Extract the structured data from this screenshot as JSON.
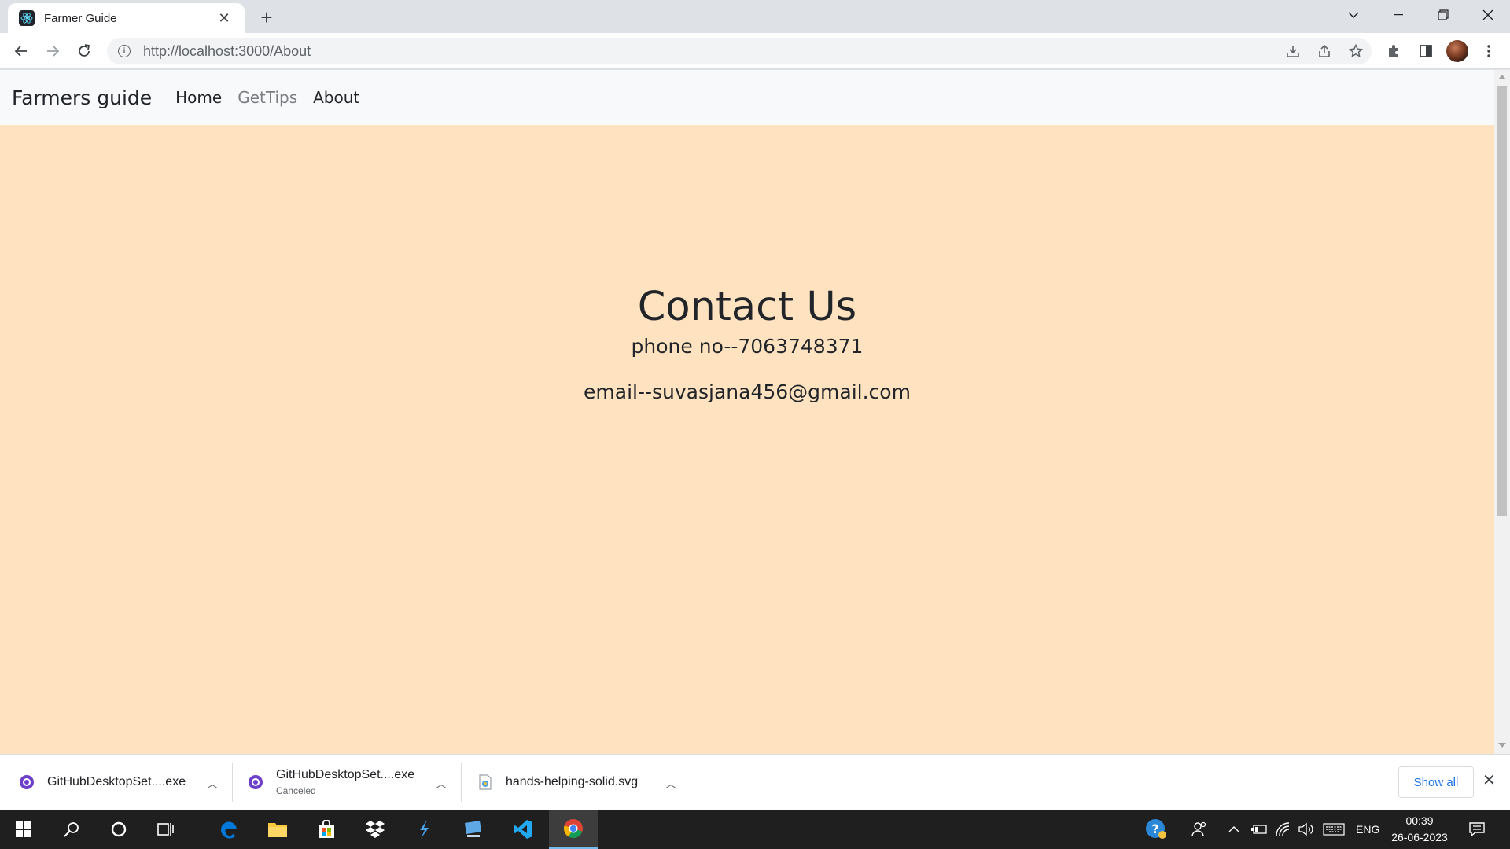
{
  "browser": {
    "tab_title": "Farmer Guide",
    "url": "http://localhost:3000/About"
  },
  "site": {
    "brand": "Farmers guide",
    "nav": [
      {
        "label": "Home",
        "state": "active"
      },
      {
        "label": "GetTips",
        "state": "muted"
      },
      {
        "label": "About",
        "state": "active"
      }
    ]
  },
  "contact": {
    "heading": "Contact Us",
    "phone": "phone no--7063748371",
    "email": "email--suvasjana456@gmail.com"
  },
  "colors": {
    "page_background": "#ffe3c0",
    "navbar_background": "#f8f9fa"
  },
  "downloads": {
    "items": [
      {
        "name": "GitHubDesktopSet....exe",
        "status": "",
        "icon": "github-desktop-icon"
      },
      {
        "name": "GitHubDesktopSet....exe",
        "status": "Canceled",
        "icon": "github-desktop-icon"
      },
      {
        "name": "hands-helping-solid.svg",
        "status": "",
        "icon": "svg-file-icon"
      }
    ],
    "show_all": "Show all"
  },
  "taskbar": {
    "language": "ENG",
    "time": "00:39",
    "date": "26-06-2023"
  }
}
